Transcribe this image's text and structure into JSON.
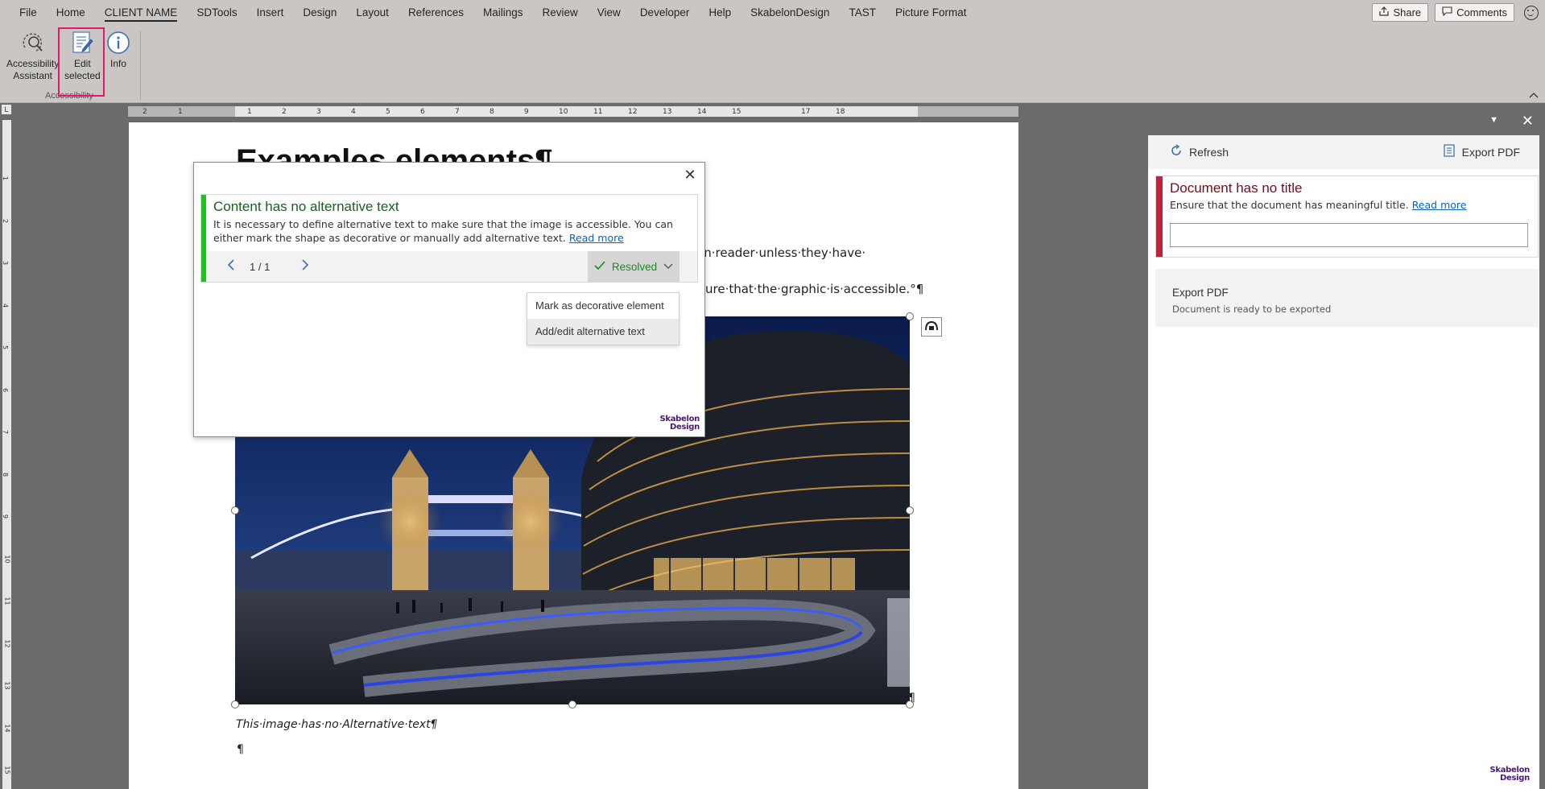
{
  "menubar": {
    "items": [
      "File",
      "Home",
      "CLIENT NAME",
      "SDTools",
      "Insert",
      "Design",
      "Layout",
      "References",
      "Mailings",
      "Review",
      "View",
      "Developer",
      "Help",
      "SkabelonDesign",
      "TAST",
      "Picture Format"
    ],
    "active_index": 2,
    "share_label": "Share",
    "comments_label": "Comments"
  },
  "ribbon": {
    "accessibility_assistant_line1": "Accessibility",
    "accessibility_assistant_line2": "Assistant",
    "edit_selected_line1": "Edit",
    "edit_selected_line2": "selected",
    "info_label": "Info",
    "group_label": "Accessibility"
  },
  "ruler": {
    "h_ticks": [
      "2",
      "1",
      "1",
      "2",
      "3",
      "4",
      "5",
      "6",
      "7",
      "8",
      "9",
      "10",
      "11",
      "12",
      "13",
      "14",
      "15",
      "17",
      "18"
    ],
    "v_ticks": [
      "1",
      "2",
      "3",
      "4",
      "5",
      "6",
      "7",
      "8",
      "9",
      "10",
      "11",
      "12",
      "13",
      "14",
      "15"
    ]
  },
  "document": {
    "title": "Examples elements¶",
    "line1_tail": "en·reader·unless·they·have·",
    "line2_tail": "ure·that·the·graphic·is·accessible.°¶",
    "caption": "This·image·has·no·Alternative·text¶",
    "pilcrow": "¶",
    "image_pilcrow": "¶"
  },
  "popup": {
    "issue_title": "Content has no alternative text",
    "issue_desc": "It is necessary to define alternative text to make sure that the image is accessible. You can either mark the shape as decorative or manually add alternative text.",
    "read_more": "Read more",
    "counter": "1 / 1",
    "resolved_label": "Resolved",
    "dropdown": [
      "Mark as decorative element",
      "Add/edit alternative text"
    ],
    "logo_line1": "Skabelon",
    "logo_line2": "Design"
  },
  "pane": {
    "refresh_label": "Refresh",
    "export_pdf_label": "Export PDF",
    "title_issue_head": "Document has no title",
    "title_issue_desc": "Ensure that the document has meaningful title.",
    "read_more": "Read more",
    "title_input_value": "",
    "export_head": "Export PDF",
    "export_sub": "Document is ready to be exported",
    "logo_line1": "Skabelon",
    "logo_line2": "Design"
  },
  "colors": {
    "resolved_green": "#1ec41e",
    "error_red": "#c0223a",
    "highlight_pink": "#e0196b",
    "link_blue": "#0563c1"
  }
}
